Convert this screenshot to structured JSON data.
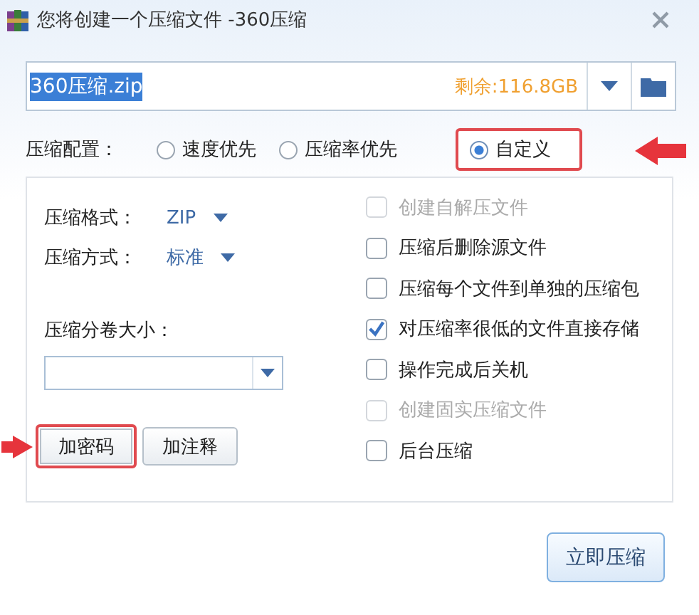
{
  "window": {
    "title": "您将创建一个压缩文件 -360压缩"
  },
  "output": {
    "filename": "360压缩.zip",
    "filename_selected": true,
    "free_space": "剩余:116.8GB"
  },
  "profile": {
    "label": "压缩配置：",
    "options": [
      {
        "label": "速度优先",
        "selected": false,
        "highlighted": false
      },
      {
        "label": "压缩率优先",
        "selected": false,
        "highlighted": false
      },
      {
        "label": "自定义",
        "selected": true,
        "highlighted": true
      }
    ]
  },
  "format": {
    "label": "压缩格式：",
    "value": "ZIP"
  },
  "method": {
    "label": "压缩方式：",
    "value": "标准"
  },
  "split": {
    "label": "压缩分卷大小："
  },
  "buttons": [
    {
      "label": "加密码",
      "highlighted": true
    },
    {
      "label": "加注释",
      "highlighted": false
    }
  ],
  "options": [
    {
      "label": "创建自解压文件",
      "checked": false,
      "disabled": true
    },
    {
      "label": "压缩后删除源文件",
      "checked": false,
      "disabled": false
    },
    {
      "label": "压缩每个文件到单独的压缩包",
      "checked": false,
      "disabled": false
    },
    {
      "label": "对压缩率很低的文件直接存储",
      "checked": true,
      "disabled": false
    },
    {
      "label": "操作完成后关机",
      "checked": false,
      "disabled": false
    },
    {
      "label": "创建固实压缩文件",
      "checked": false,
      "disabled": true
    },
    {
      "label": "后台压缩",
      "checked": false,
      "disabled": false
    }
  ],
  "primary_button": "立即压缩"
}
